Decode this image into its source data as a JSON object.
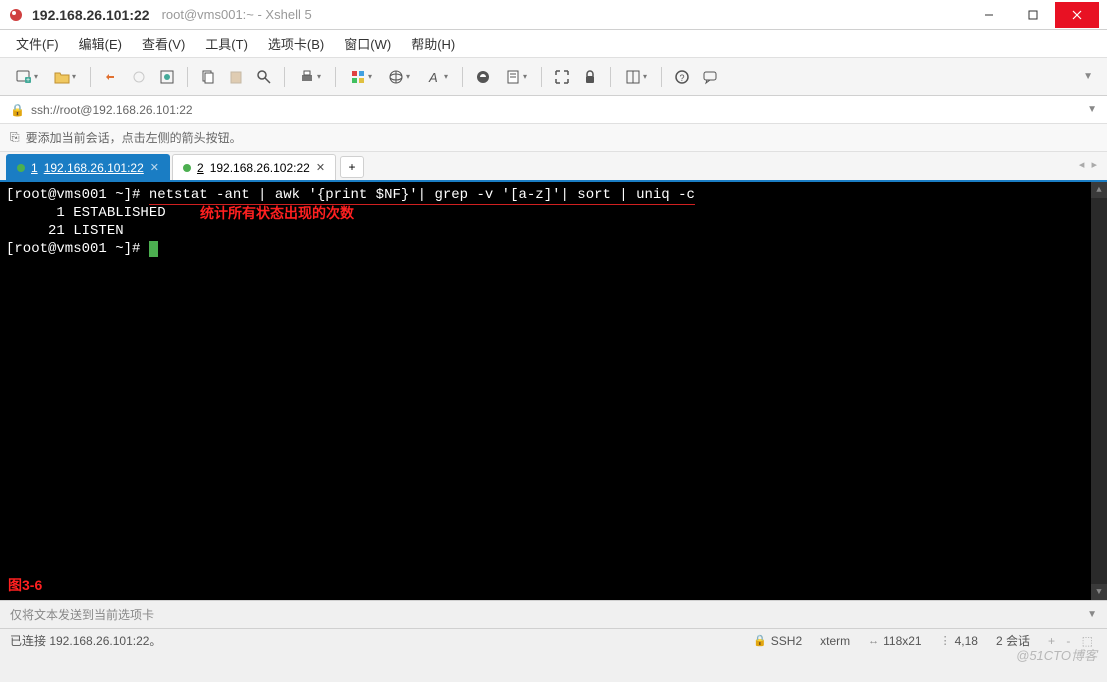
{
  "titlebar": {
    "title": "192.168.26.101:22",
    "subtitle": "root@vms001:~ - Xshell 5"
  },
  "menubar": {
    "items": [
      "文件(F)",
      "编辑(E)",
      "查看(V)",
      "工具(T)",
      "选项卡(B)",
      "窗口(W)",
      "帮助(H)"
    ]
  },
  "addressbar": {
    "url": "ssh://root@192.168.26.101:22"
  },
  "hintbar": {
    "text": "要添加当前会话，点击左侧的箭头按钮。"
  },
  "tabs": [
    {
      "num": "1",
      "label": "192.168.26.101:22",
      "active": true
    },
    {
      "num": "2",
      "label": "192.168.26.102:22",
      "active": false
    }
  ],
  "terminal": {
    "prompt1_user": "[root@vms001 ~]#",
    "command": "netstat -ant | awk '{print $NF}'| grep -v '[a-z]'| sort | uniq -c",
    "out1": "      1 ESTABLISHED",
    "out2": "     21 LISTEN",
    "prompt2_user": "[root@vms001 ~]#",
    "annotation": "统计所有状态出现的次数",
    "figlabel": "图3-6"
  },
  "sendbar": {
    "text": "仅将文本发送到当前选项卡"
  },
  "statusbar": {
    "connected": "已连接 192.168.26.101:22。",
    "protocol": "SSH2",
    "termtype": "xterm",
    "size": "118x21",
    "cursor": "4,18",
    "sessions": "2 会话"
  },
  "watermark": "@51CTO博客"
}
